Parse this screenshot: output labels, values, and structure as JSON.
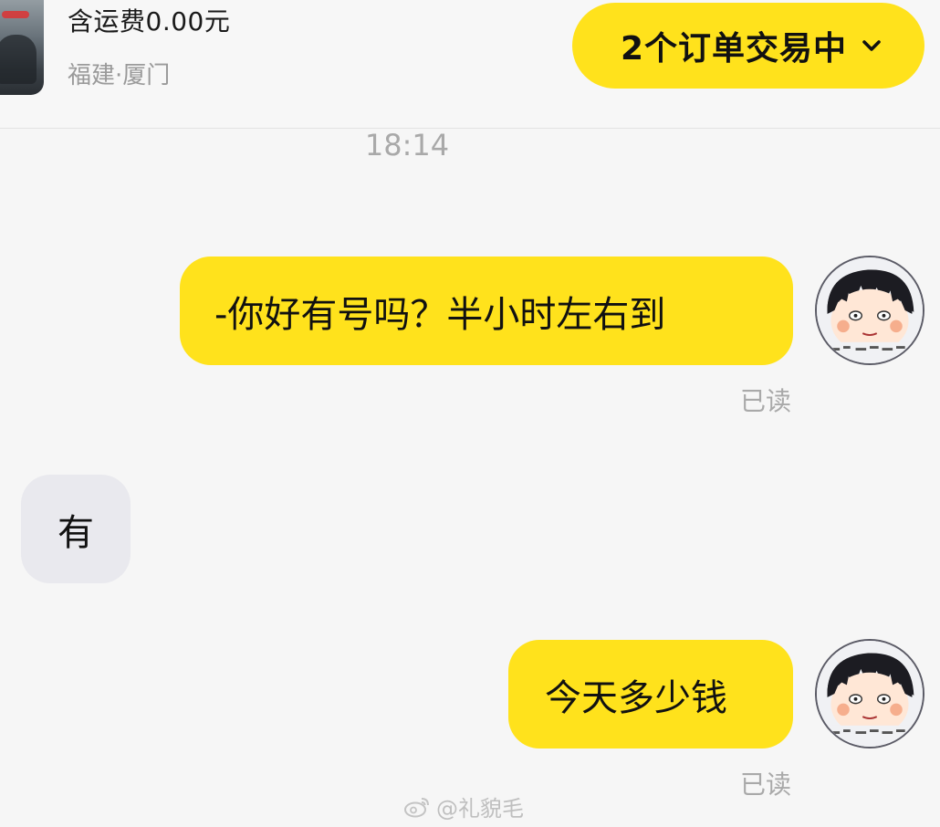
{
  "header": {
    "price_text": "含运费0.00元",
    "location_text": "福建·厦门",
    "orders_button_label": "2个订单交易中"
  },
  "chat": {
    "timestamp": "18:14",
    "messages": [
      {
        "direction": "outgoing",
        "text": "-你好有号吗？半小时左右到",
        "status": "已读"
      },
      {
        "direction": "incoming",
        "text": "有"
      },
      {
        "direction": "outgoing",
        "text": "今天多少钱",
        "status": "已读"
      }
    ]
  },
  "watermark": "@礼貌毛",
  "colors": {
    "accent_yellow": "#ffe21c",
    "incoming_bubble": "#e9e9ee",
    "background": "#f6f6f6",
    "muted_text": "#a9a9a9"
  },
  "icons": [
    "chevron-down-icon",
    "weibo-icon"
  ]
}
